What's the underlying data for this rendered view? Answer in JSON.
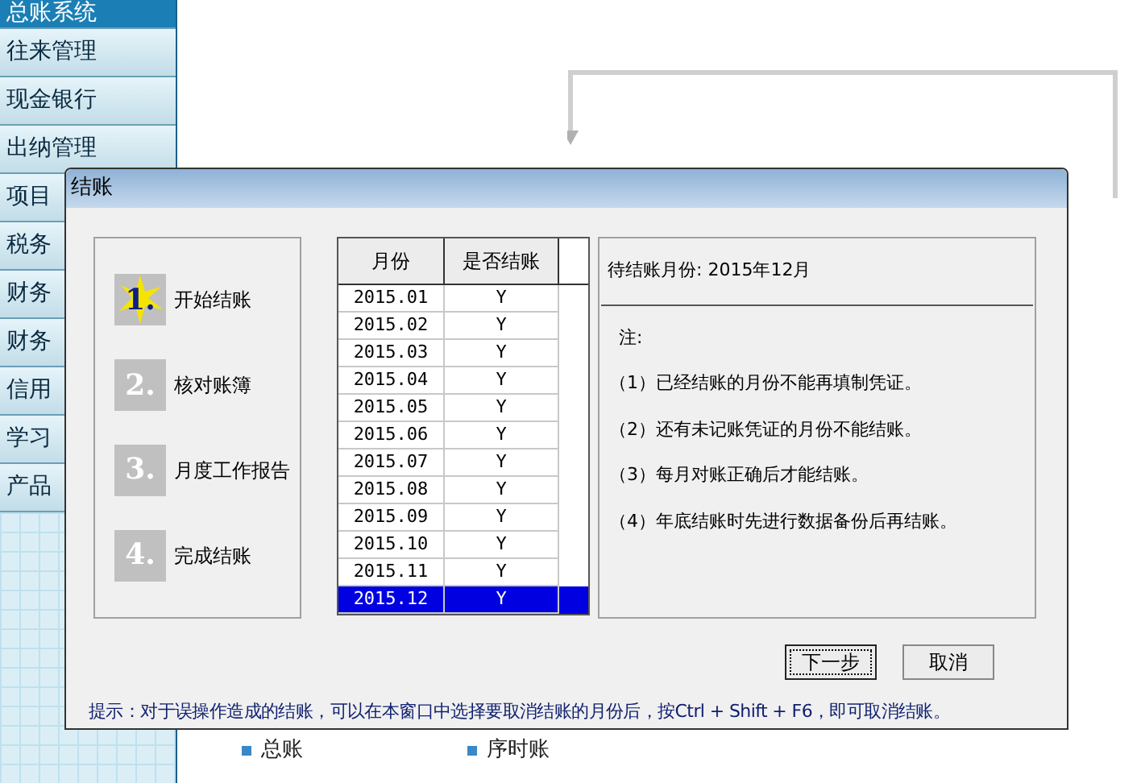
{
  "sidebar": {
    "items": [
      {
        "label": "总账系统",
        "selected": true
      },
      {
        "label": "往来管理",
        "selected": false
      },
      {
        "label": "现金银行",
        "selected": false
      },
      {
        "label": "出纳管理",
        "selected": false
      },
      {
        "label": "项目",
        "selected": false
      },
      {
        "label": "税务",
        "selected": false
      },
      {
        "label": "财务",
        "selected": false
      },
      {
        "label": "财务",
        "selected": false
      },
      {
        "label": "信用",
        "selected": false
      },
      {
        "label": "学习",
        "selected": false
      },
      {
        "label": "产品",
        "selected": false
      }
    ]
  },
  "menu": [
    {
      "label": "总账"
    },
    {
      "label": "序时账"
    }
  ],
  "dialog": {
    "title": "结账",
    "steps": [
      {
        "number": "1.",
        "label": "开始结账",
        "active": true
      },
      {
        "number": "2.",
        "label": "核对账簿",
        "active": false
      },
      {
        "number": "3.",
        "label": "月度工作报告",
        "active": false
      },
      {
        "number": "4.",
        "label": "完成结账",
        "active": false
      }
    ],
    "table": {
      "columns": [
        "月份",
        "是否结账"
      ],
      "rows": [
        {
          "month": "2015.01",
          "closed": "Y",
          "selected": false
        },
        {
          "month": "2015.02",
          "closed": "Y",
          "selected": false
        },
        {
          "month": "2015.03",
          "closed": "Y",
          "selected": false
        },
        {
          "month": "2015.04",
          "closed": "Y",
          "selected": false
        },
        {
          "month": "2015.05",
          "closed": "Y",
          "selected": false
        },
        {
          "month": "2015.06",
          "closed": "Y",
          "selected": false
        },
        {
          "month": "2015.07",
          "closed": "Y",
          "selected": false
        },
        {
          "month": "2015.08",
          "closed": "Y",
          "selected": false
        },
        {
          "month": "2015.09",
          "closed": "Y",
          "selected": false
        },
        {
          "month": "2015.10",
          "closed": "Y",
          "selected": false
        },
        {
          "month": "2015.11",
          "closed": "Y",
          "selected": false
        },
        {
          "month": "2015.12",
          "closed": "Y",
          "selected": true
        }
      ]
    },
    "pending": "待结账月份: 2015年12月",
    "note_title": "注:",
    "notes": [
      "（1）已经结账的月份不能再填制凭证。",
      "（2）还有未记账凭证的月份不能结账。",
      "（3）每月对账正确后才能结账。",
      "（4）年底结账时先进行数据备份后再结账。"
    ],
    "buttons": [
      {
        "label": "下一步",
        "focused": true
      },
      {
        "label": "取消",
        "focused": false
      }
    ],
    "hint": "提示：对于误操作造成的结账，可以在本窗口中选择要取消结账的月份后，按Ctrl + Shift + F6，即可取消结账。"
  }
}
